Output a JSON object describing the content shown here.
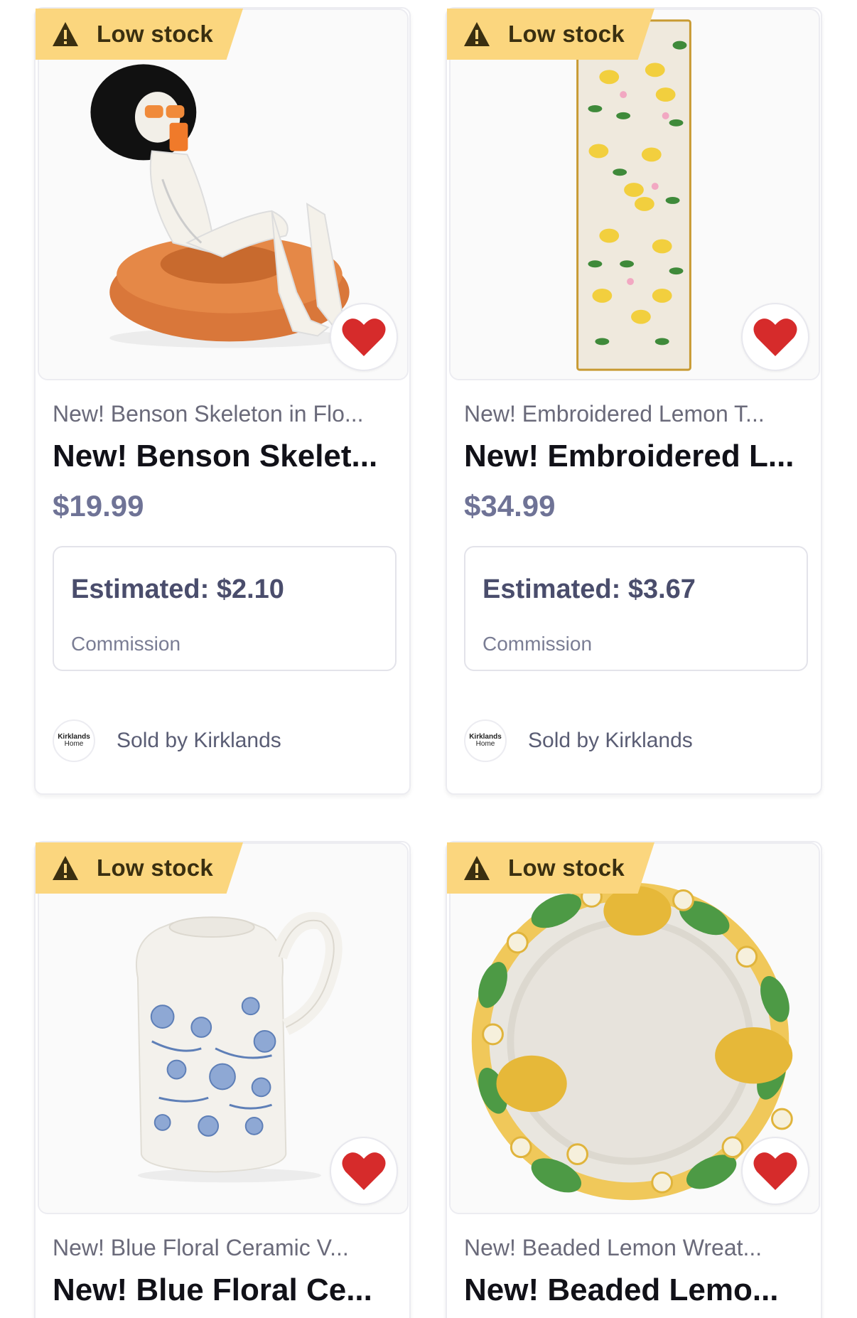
{
  "badge_icon": "warning-triangle-icon",
  "favorite_icon": "heart-icon",
  "colors": {
    "badge_bg": "#fbd67e",
    "heart": "#d62b2b",
    "price": "#6f7396"
  },
  "products": [
    {
      "badge": "Low stock",
      "subtitle": "New! Benson Skeleton in Flo...",
      "title": "New! Benson Skelet...",
      "price": "$19.99",
      "estimated": "Estimated: $2.10",
      "commission_label": "Commission",
      "seller_logo_line1": "Kirklands",
      "seller_logo_line2": "Home",
      "seller": "Sold by Kirklands",
      "image": "skeleton-on-pool-float"
    },
    {
      "badge": "Low stock",
      "subtitle": "New! Embroidered Lemon T...",
      "title": "New! Embroidered L...",
      "price": "$34.99",
      "estimated": "Estimated: $3.67",
      "commission_label": "Commission",
      "seller_logo_line1": "Kirklands",
      "seller_logo_line2": "Home",
      "seller": "Sold by Kirklands",
      "image": "lemon-table-runner"
    },
    {
      "badge": "Low stock",
      "subtitle": "New! Blue Floral Ceramic V...",
      "title": "New! Blue Floral Ce...",
      "image": "blue-floral-ceramic-jug"
    },
    {
      "badge": "Low stock",
      "subtitle": "New! Beaded Lemon Wreat...",
      "title": "New! Beaded Lemo...",
      "image": "beaded-lemon-placemat"
    }
  ]
}
